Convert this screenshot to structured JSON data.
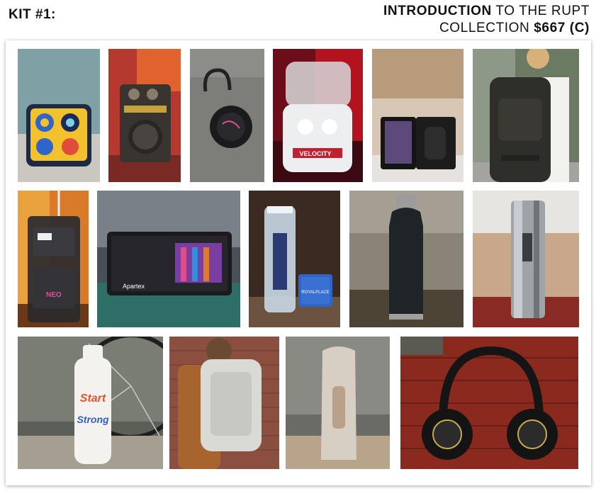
{
  "header": {
    "kit_label": "KIT #1:",
    "intro_bold": "INTRODUCTION",
    "intro_light": "TO THE RUPT",
    "collection_light": "COLLECTION",
    "price": "$667 (C)"
  },
  "product_labels": {
    "earbuds_brand": "VELOCITY",
    "charger_brand": "Apartex",
    "bottle_word1": "Start",
    "bottle_word2": "Strong",
    "tin_label": "ROYALPLACE"
  }
}
